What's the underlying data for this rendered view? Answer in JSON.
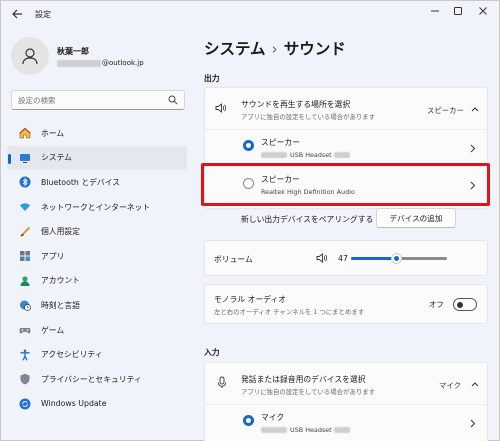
{
  "window": {
    "title": "設定",
    "controls": [
      "minimize-icon",
      "maximize-icon",
      "close-icon"
    ]
  },
  "profile": {
    "name": "秋葉一郎",
    "email_suffix": "@outlook.jp"
  },
  "search": {
    "placeholder": "設定の検索"
  },
  "nav": {
    "items": [
      {
        "label": "ホーム",
        "icon": "home-icon"
      },
      {
        "label": "システム",
        "icon": "monitor-icon",
        "active": true
      },
      {
        "label": "Bluetooth とデバイス",
        "icon": "bluetooth-icon"
      },
      {
        "label": "ネットワークとインターネット",
        "icon": "wifi-icon"
      },
      {
        "label": "個人用設定",
        "icon": "brush-icon"
      },
      {
        "label": "アプリ",
        "icon": "apps-icon"
      },
      {
        "label": "アカウント",
        "icon": "account-icon"
      },
      {
        "label": "時刻と言語",
        "icon": "globe-clock-icon"
      },
      {
        "label": "ゲーム",
        "icon": "gamepad-icon"
      },
      {
        "label": "アクセシビリティ",
        "icon": "accessibility-icon"
      },
      {
        "label": "プライバシーとセキュリティ",
        "icon": "shield-icon"
      },
      {
        "label": "Windows Update",
        "icon": "update-icon"
      }
    ]
  },
  "breadcrumb": {
    "parent": "システム",
    "separator": "›",
    "current": "サウンド"
  },
  "output": {
    "section_label": "出力",
    "select_title": "サウンドを再生する場所を選択",
    "select_sub": "アプリに独自の設定をしている場合があります",
    "select_value": "スピーカー",
    "devices": [
      {
        "name": "スピーカー",
        "detail": "USB Headset",
        "selected": true
      },
      {
        "name": "スピーカー",
        "detail": "Realtek High Definition Audio",
        "selected": false
      }
    ],
    "pair_label": "新しい出力デバイスをペアリングする",
    "add_device_label": "デバイスの追加"
  },
  "volume": {
    "label": "ボリューム",
    "value": 47,
    "value_text": "47"
  },
  "mono": {
    "title": "モノラル オーディオ",
    "sub": "左と右のオーディオ チャンネルを 1 つにまとめます",
    "state_label": "オフ",
    "on": false
  },
  "input": {
    "section_label": "入力",
    "select_title": "発話または録音用のデバイスを選択",
    "select_sub": "アプリに独自の設定をしている場合があります",
    "select_value": "マイク",
    "devices": [
      {
        "name": "マイク",
        "detail": "USB Headset",
        "selected": true
      }
    ]
  },
  "colors": {
    "accent": "#1868c8",
    "highlight": "#e0151a"
  }
}
